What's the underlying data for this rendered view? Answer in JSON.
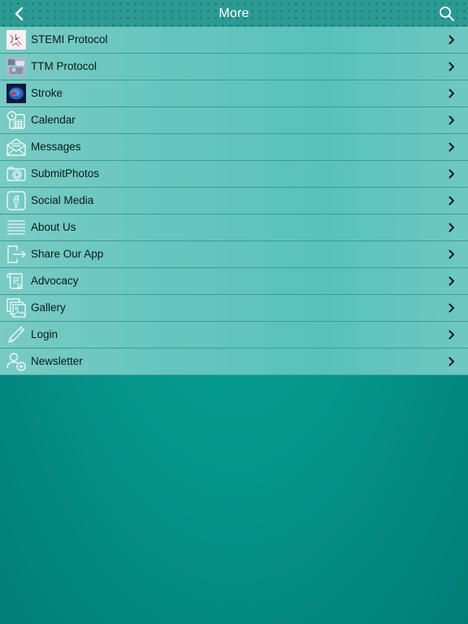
{
  "header": {
    "title": "More"
  },
  "menu": {
    "items": [
      {
        "label": "STEMI Protocol",
        "icon": "stemi-photo-icon"
      },
      {
        "label": "TTM Protocol",
        "icon": "ttm-photo-icon"
      },
      {
        "label": "Stroke",
        "icon": "brain-photo-icon"
      },
      {
        "label": "Calendar",
        "icon": "calendar-icon"
      },
      {
        "label": "Messages",
        "icon": "envelope-icon"
      },
      {
        "label": "SubmitPhotos",
        "icon": "camera-icon"
      },
      {
        "label": "Social Media",
        "icon": "facebook-icon"
      },
      {
        "label": "About Us",
        "icon": "lines-icon"
      },
      {
        "label": "Share Our App",
        "icon": "share-icon"
      },
      {
        "label": "Advocacy",
        "icon": "scroll-icon"
      },
      {
        "label": "Gallery",
        "icon": "gallery-icon"
      },
      {
        "label": "Login",
        "icon": "pencil-icon"
      },
      {
        "label": "Newsletter",
        "icon": "add-user-icon"
      }
    ]
  }
}
